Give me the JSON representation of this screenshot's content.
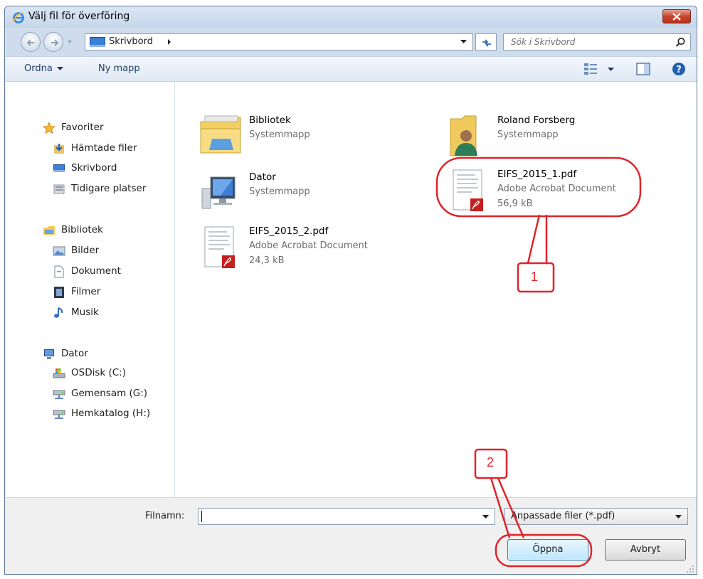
{
  "window": {
    "title": "Välj fil för överföring",
    "accent": "#c7452f"
  },
  "address": {
    "location": "Skrivbord",
    "search_placeholder": "Sök i Skrivbord"
  },
  "toolbar": {
    "organize_label": "Ordna",
    "new_folder_label": "Ny mapp"
  },
  "sidebar": {
    "groups": [
      {
        "label": "Favoriter",
        "icon": "star-icon",
        "items": [
          {
            "label": "Hämtade filer",
            "icon": "downloads-icon"
          },
          {
            "label": "Skrivbord",
            "icon": "desktop-icon"
          },
          {
            "label": "Tidigare platser",
            "icon": "recent-places-icon"
          }
        ]
      },
      {
        "label": "Bibliotek",
        "icon": "libraries-icon",
        "items": [
          {
            "label": "Bilder",
            "icon": "pictures-icon"
          },
          {
            "label": "Dokument",
            "icon": "documents-icon"
          },
          {
            "label": "Filmer",
            "icon": "videos-icon"
          },
          {
            "label": "Musik",
            "icon": "music-icon"
          }
        ]
      },
      {
        "label": "Dator",
        "icon": "computer-icon",
        "items": [
          {
            "label": "OSDisk (C:)",
            "icon": "local-disk-icon"
          },
          {
            "label": "Gemensam (G:)",
            "icon": "network-drive-icon"
          },
          {
            "label": "Hemkatalog (H:)",
            "icon": "network-drive-icon"
          }
        ]
      }
    ]
  },
  "files": [
    {
      "name": "Bibliotek",
      "type": "Systemmapp",
      "size": "",
      "icon": "libraries-folder-icon"
    },
    {
      "name": "Roland Forsberg",
      "type": "Systemmapp",
      "size": "",
      "icon": "user-folder-icon"
    },
    {
      "name": "Dator",
      "type": "Systemmapp",
      "size": "",
      "icon": "computer-icon"
    },
    {
      "name": "EIFS_2015_1.pdf",
      "type": "Adobe Acrobat Document",
      "size": "56,9 kB",
      "icon": "pdf-file-icon"
    },
    {
      "name": "EIFS_2015_2.pdf",
      "type": "Adobe Acrobat Document",
      "size": "24,3 kB",
      "icon": "pdf-file-icon"
    }
  ],
  "bottom": {
    "filename_label": "Filnamn:",
    "filename_value": "",
    "filter_value": "Anpassade filer (*.pdf)",
    "open_label": "Öppna",
    "cancel_label": "Avbryt"
  },
  "annotations": {
    "color": "#e0242a",
    "step1": "1",
    "step2": "2"
  }
}
